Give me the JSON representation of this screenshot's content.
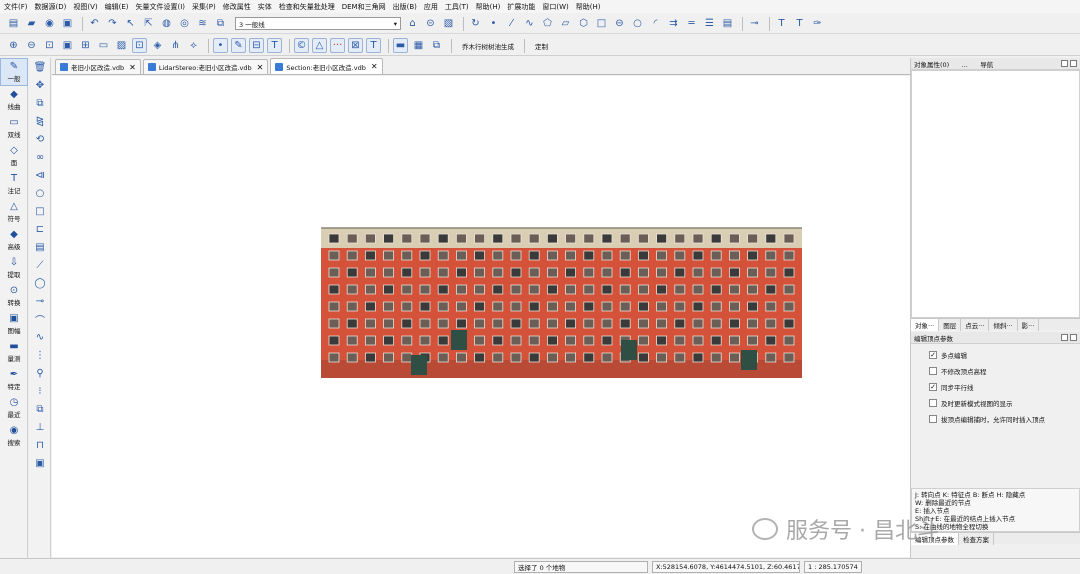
{
  "menu": [
    "文件(F)",
    "数据源(D)",
    "视图(V)",
    "编辑(E)",
    "矢量文件设置(I)",
    "采集(P)",
    "修改属性",
    "实体",
    "检查和矢量批处理",
    "DEM和三角网",
    "出版(B)",
    "应用",
    "工具(T)",
    "帮助(H)",
    "扩展功能",
    "窗口(W)",
    "帮助(H)"
  ],
  "toolbar": {
    "layer_combo": "3 一般线",
    "tree_label": "乔木行树树池生成",
    "custom_label": "定制"
  },
  "left_tools": [
    {
      "label": "一般",
      "icon": "✎"
    },
    {
      "label": "线曲",
      "icon": "◆"
    },
    {
      "label": "双线",
      "icon": "▭"
    },
    {
      "label": "面",
      "icon": "◇"
    },
    {
      "label": "注记",
      "icon": "T"
    },
    {
      "label": "符号",
      "icon": "△"
    },
    {
      "label": "高级",
      "icon": "◆"
    },
    {
      "label": "提取",
      "icon": "⇩"
    },
    {
      "label": "转换",
      "icon": "⊙"
    },
    {
      "label": "图幅",
      "icon": "▣"
    },
    {
      "label": "量测",
      "icon": "▬"
    },
    {
      "label": "特定",
      "icon": "✒"
    },
    {
      "label": "最近",
      "icon": "◷"
    },
    {
      "label": "搜索",
      "icon": "◉"
    }
  ],
  "tabs": [
    {
      "label": "老旧小区改造.vdb",
      "active": false
    },
    {
      "label": "LidarStereo:老旧小区改造.vdb",
      "active": false
    },
    {
      "label": "Section:老旧小区改造.vdb",
      "active": true
    }
  ],
  "right_panel": {
    "top_title": "对象属性(0)",
    "top_dots": "...",
    "nav_label": "导航",
    "top_tabs": [
      "对象···",
      "图层",
      "点云···",
      "倾斜···",
      "影···"
    ],
    "edit_title": "编辑顶点参数",
    "options": [
      {
        "label": "多点编辑",
        "checked": true
      },
      {
        "label": "不修改顶点高程",
        "checked": false
      },
      {
        "label": "同步平行线",
        "checked": true
      },
      {
        "label": "及时更新模式视图的显示",
        "checked": false
      },
      {
        "label": "拔顶点编辑捕时，允许同时插入顶点",
        "checked": false
      }
    ],
    "hints": [
      "J: 转向点    K: 特征点    B: 断点    H: 隐藏点",
      "W: 删除最近的节点",
      "E: 插入节点",
      "Shift+E: 在最近的结点上插入节点",
      "S: 在曲线的地物全程切换"
    ],
    "bottom_tabs": [
      "编辑顶点参数",
      "检查方案"
    ]
  },
  "status": {
    "selection": "选择了 0 个地物",
    "coords": "X:528154.6078, Y:4614474.5101, Z:60.4617",
    "scale": "1 : 285.170574"
  },
  "watermark": "服务号 · 昌北斗"
}
